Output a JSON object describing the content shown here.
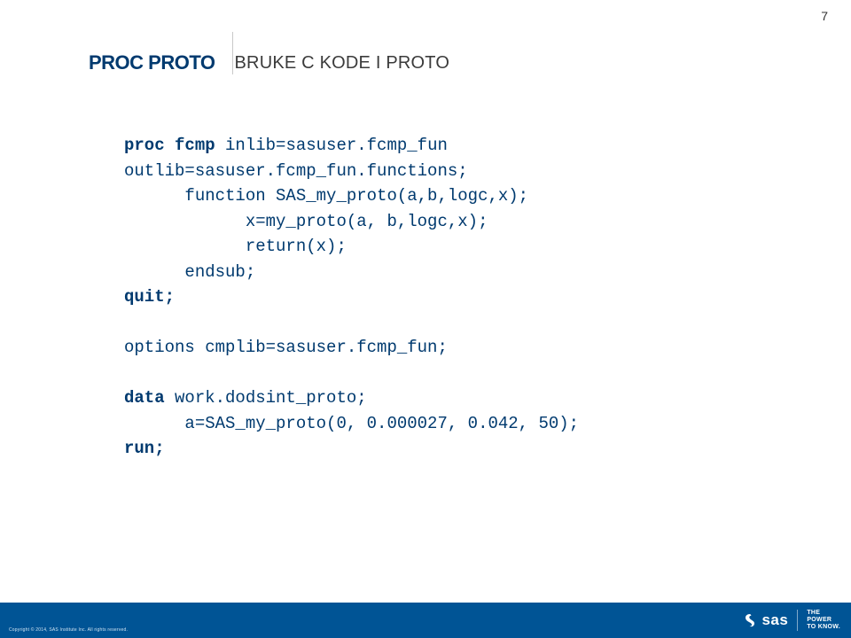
{
  "page_number": "7",
  "header": {
    "title": "PROC PROTO",
    "subtitle": "BRUKE C KODE I PROTO"
  },
  "code": {
    "kw_proc_fcmp": "proc fcmp",
    "inlib_arg": " inlib=sasuser.fcmp_fun",
    "outlib_line": "outlib=sasuser.fcmp_fun.functions;",
    "fn_line": "      function SAS_my_proto(a,b,logc,x);",
    "body1": "            x=my_proto(a, b,logc,x);",
    "body2": "            return(x);",
    "endsub": "      endsub;",
    "kw_quit": "quit;",
    "options_line": "options cmplib=sasuser.fcmp_fun;",
    "kw_data": "data",
    "data_rest": " work.dodsint_proto;",
    "assign_line": "      a=SAS_my_proto(0, 0.000027, 0.042, 50);",
    "kw_run": "run;"
  },
  "footer": {
    "copyright": "Copyright © 2014, SAS Institute Inc. All rights reserved.",
    "logo_text": "sas",
    "tagline_l1": "THE",
    "tagline_l2": "POWER",
    "tagline_l3": "TO KNOW."
  }
}
